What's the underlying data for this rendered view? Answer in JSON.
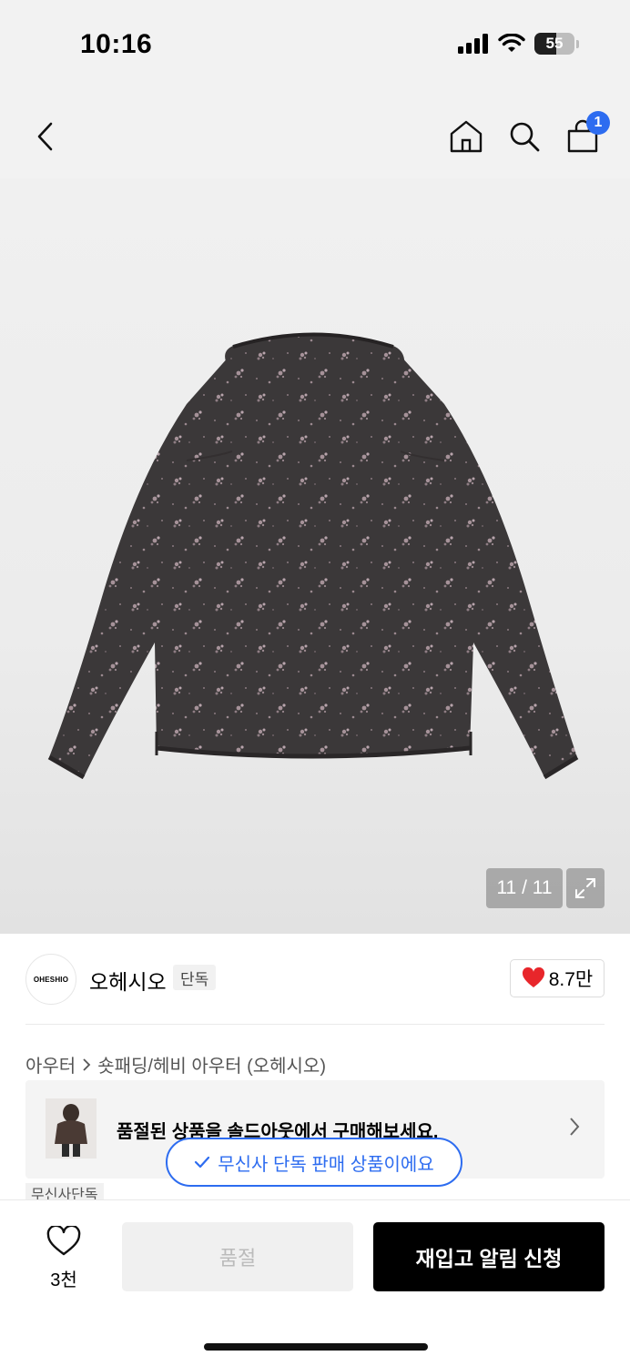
{
  "status_bar": {
    "time": "10:16",
    "battery": "55"
  },
  "nav": {
    "cart_count": "1"
  },
  "gallery": {
    "counter": "11 / 11",
    "image_alt": "Dark floral print reversible jacket, back view"
  },
  "brand": {
    "logo_text": "OHESHIO",
    "name": "오헤시오",
    "tag": "단독",
    "like_count": "8.7만"
  },
  "breadcrumb": {
    "category": "아우터",
    "subcategory": "숏패딩/헤비 아우터 (오헤시오)"
  },
  "soldout_banner": {
    "text": "품절된 상품을 솔드아웃에서 구매해보세요."
  },
  "tooltip": {
    "text": "무신사 단독 판매 상품이에요"
  },
  "chip": {
    "text": "무신사단독"
  },
  "bottom_bar": {
    "wish_count": "3천",
    "soldout_label": "품절",
    "restock_label": "재입고 알림 신청"
  },
  "colors": {
    "accent": "#2d6cf0",
    "heart": "#e8262b",
    "jacket": "#3b3839"
  }
}
